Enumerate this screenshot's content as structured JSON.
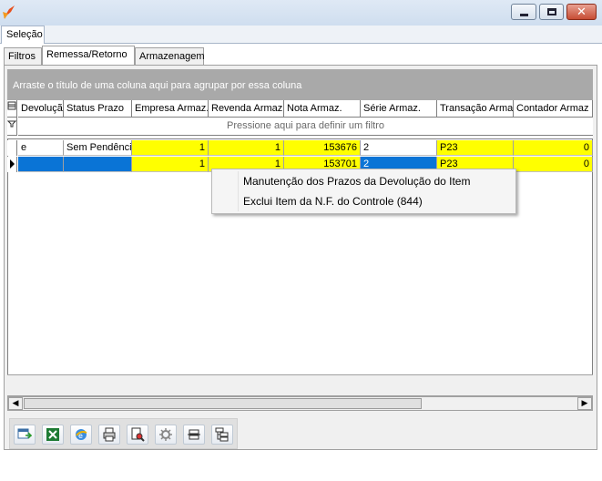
{
  "window": {
    "controls": [
      "minimize-icon",
      "maximize-icon",
      "close-icon"
    ],
    "close_glyph": "✕"
  },
  "top_tab": {
    "label": "Seleção"
  },
  "tabs": [
    {
      "label": "Filtros",
      "active": false
    },
    {
      "label": "Remessa/Retorno",
      "active": true
    },
    {
      "label": "Armazenagem",
      "active": false
    }
  ],
  "grid": {
    "group_hint": "Arraste o título de uma coluna aqui para agrupar por essa coluna",
    "filter_hint": "Pressione aqui para definir um filtro",
    "columns": [
      "Devolução",
      "Status Prazo",
      "Empresa Armaz.",
      "Revenda Armaz.",
      "Nota Armaz.",
      "Série Armaz.",
      "Transação Armaz.",
      "Contador Armaz"
    ],
    "rows": [
      {
        "devolucao": "e",
        "status_prazo": "Sem Pendência",
        "empresa": "1",
        "revenda": "1",
        "nota": "153676",
        "serie": "2",
        "transacao": "P23",
        "contador": "0"
      },
      {
        "devolucao": "",
        "status_prazo": "",
        "empresa": "1",
        "revenda": "1",
        "nota": "153701",
        "serie": "2",
        "transacao": "P23",
        "contador": "0"
      }
    ],
    "highlight_color": "#ffff00",
    "selection_color": "#0a74d6"
  },
  "context_menu": {
    "items": [
      "Manutenção dos Prazos da Devolução do Item",
      "Exclui Item da N.F. do Controle (844)"
    ]
  },
  "toolbar": {
    "buttons": [
      "export-icon",
      "excel-icon",
      "browser-icon",
      "print-icon",
      "print-preview-icon",
      "settings-icon",
      "collapse-icon",
      "expand-icon"
    ]
  }
}
